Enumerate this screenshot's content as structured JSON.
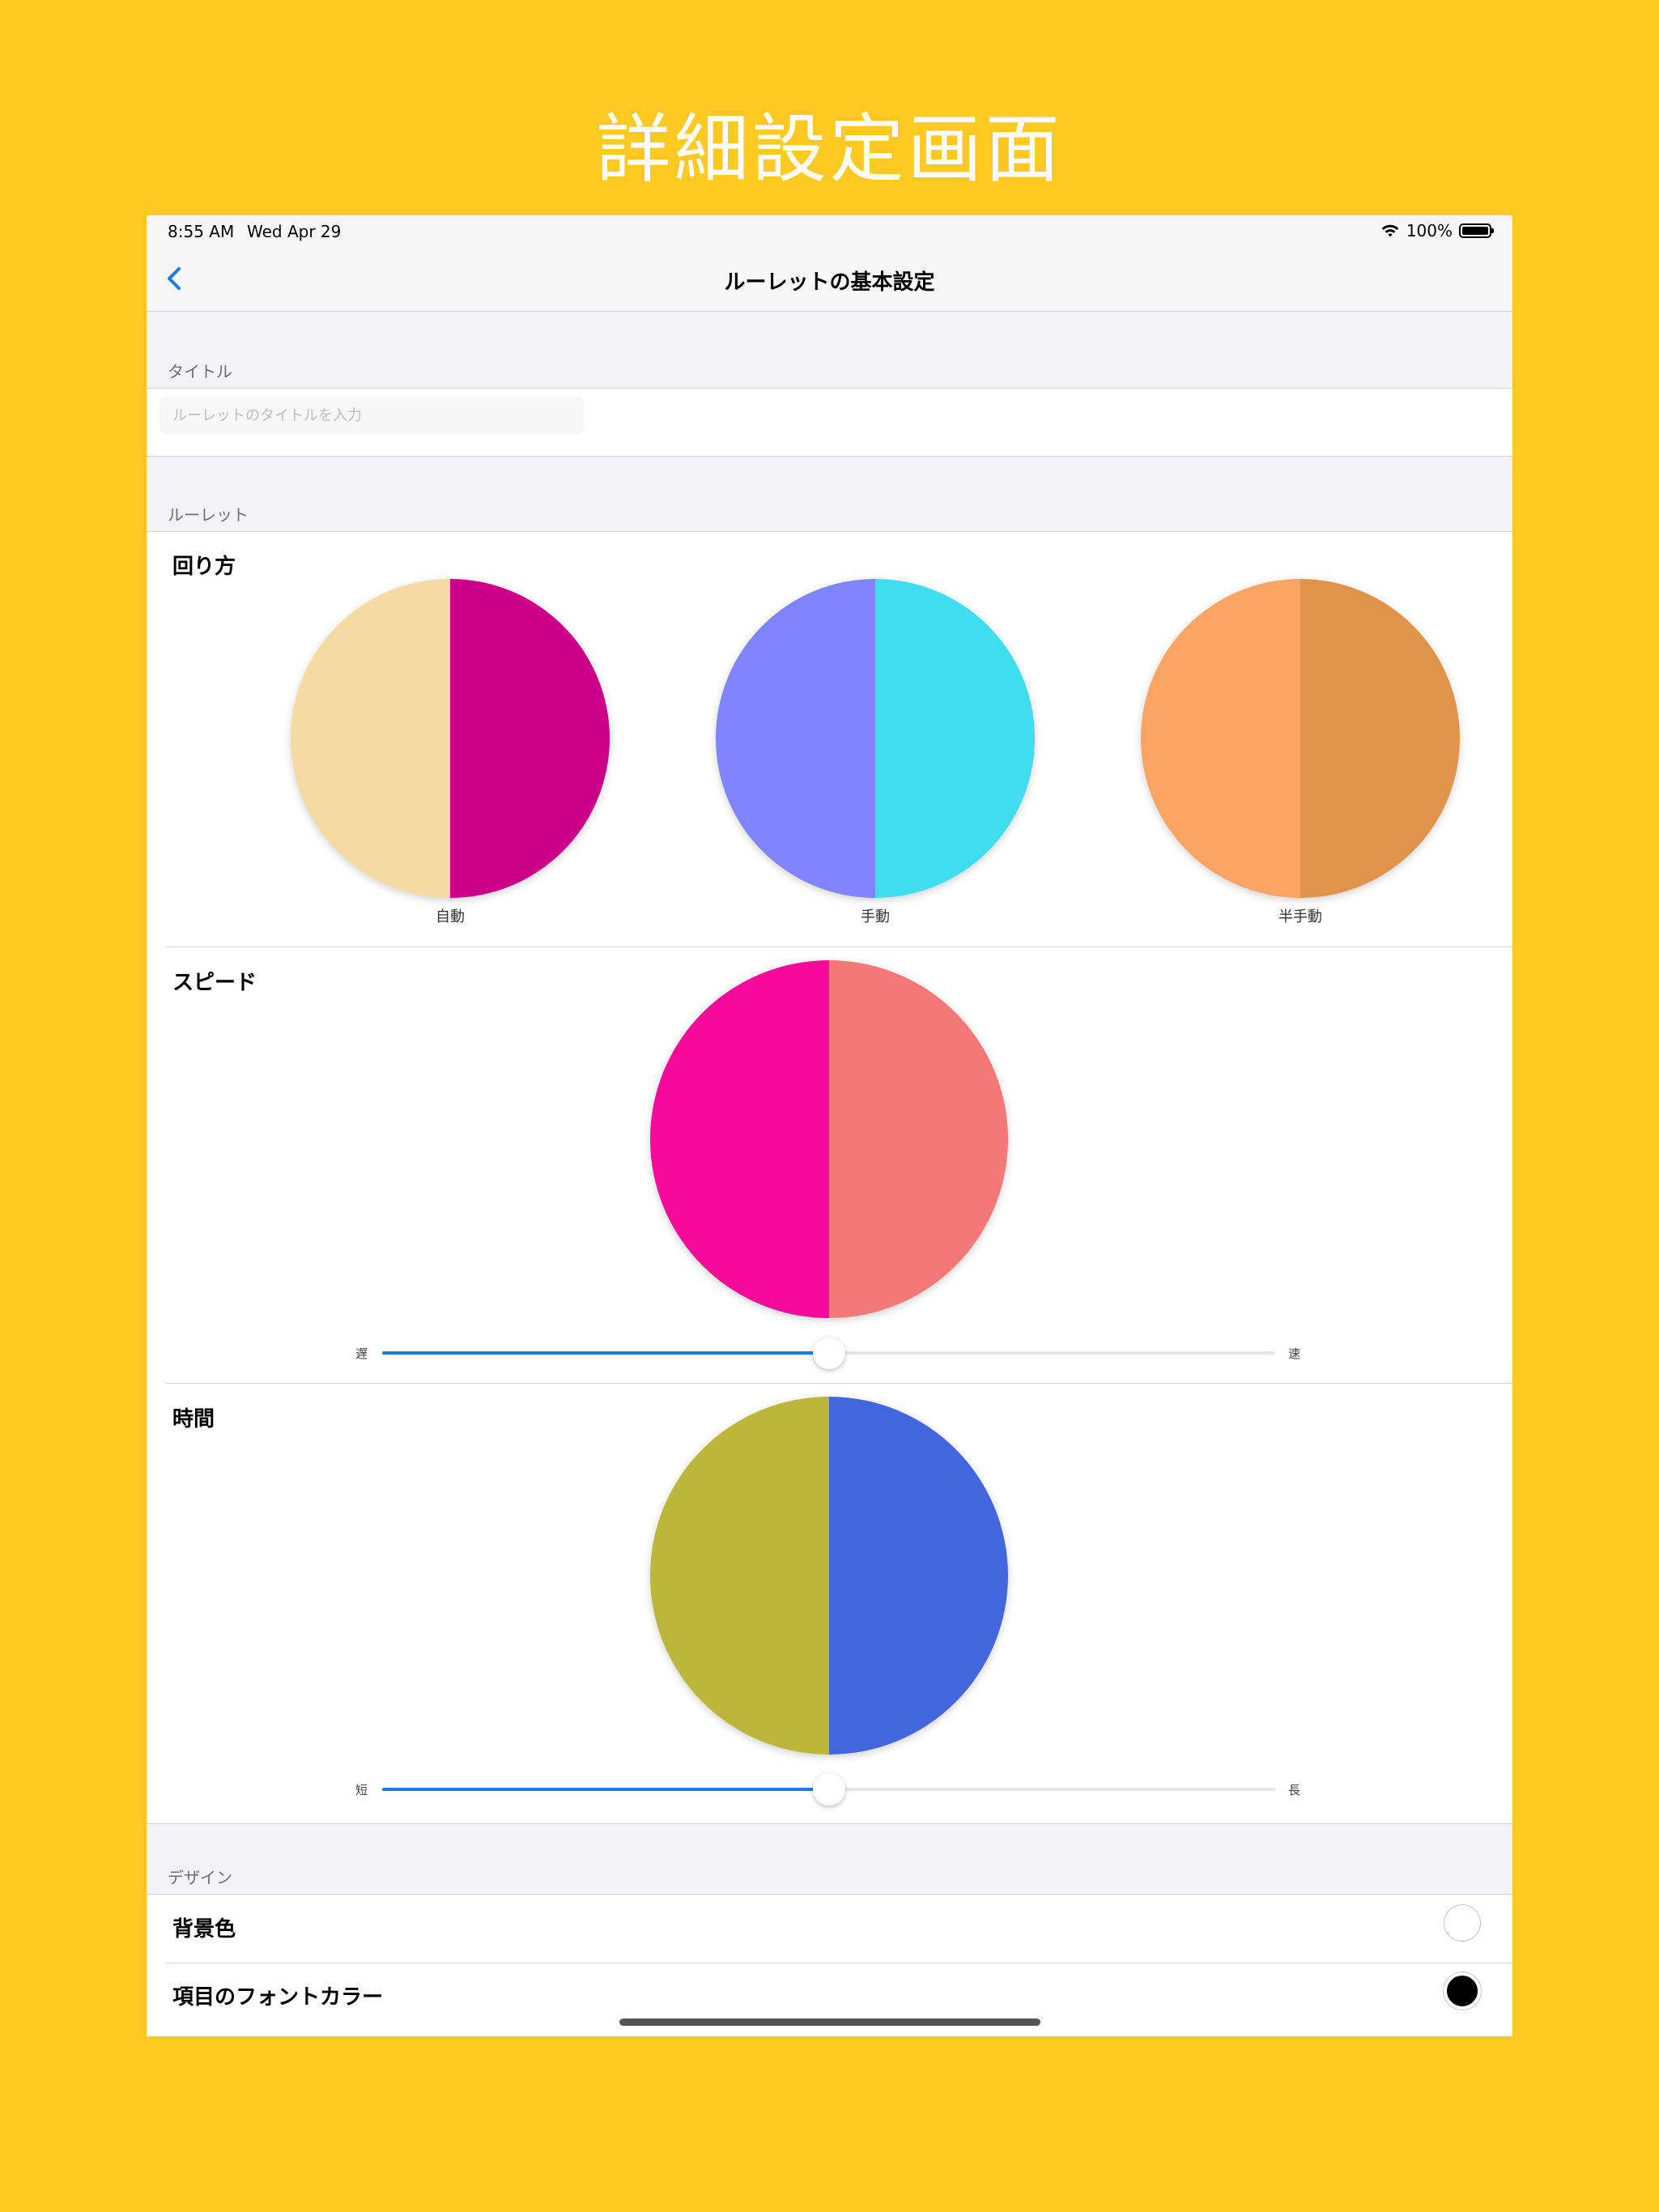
{
  "headline": "詳細設定画面",
  "status_bar": {
    "time": "8:55 AM",
    "date": "Wed Apr 29",
    "battery": "100%"
  },
  "nav": {
    "title": "ルーレットの基本設定",
    "back_icon": "chevron-left-icon"
  },
  "sections": {
    "title_header": "タイトル",
    "title_placeholder": "ルーレットのタイトルを入力",
    "roulette_header": "ルーレット",
    "design_header": "デザイン"
  },
  "spin_mode": {
    "label": "回り方",
    "options": [
      {
        "caption": "自動",
        "left_color": "#F5DBA3",
        "right_color": "#CC0088"
      },
      {
        "caption": "手動",
        "left_color": "#8085FE",
        "right_color": "#40DDEE"
      },
      {
        "caption": "半手動",
        "left_color": "#FBA464",
        "right_color": "#E0944B"
      }
    ]
  },
  "speed": {
    "label": "スピード",
    "left_color": "#F70A99",
    "right_color": "#F27977",
    "min_label": "遅",
    "max_label": "速",
    "value": 0.5
  },
  "time": {
    "label": "時間",
    "left_color": "#BCB73A",
    "right_color": "#4366DD",
    "min_label": "短",
    "max_label": "長",
    "value": 0.5
  },
  "design": {
    "background_color_label": "背景色",
    "background_color_value": "#FFFFFF",
    "font_color_label": "項目のフォントカラー",
    "font_color_value": "#000000"
  },
  "colors": {
    "accent": "#1A7CE8",
    "page_bg": "#FEC923"
  }
}
